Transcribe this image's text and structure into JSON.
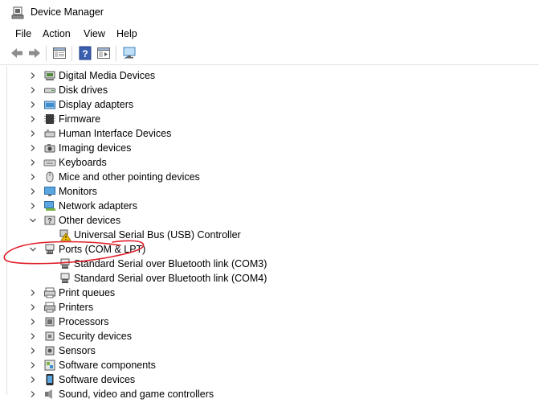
{
  "window": {
    "title": "Device Manager"
  },
  "menu": [
    "File",
    "Action",
    "View",
    "Help"
  ],
  "toolbar": [
    {
      "icon": "back-arrow-icon"
    },
    {
      "icon": "forward-arrow-icon"
    },
    {
      "icon": "show-hide-console-tree-icon"
    },
    {
      "icon": "help-icon"
    },
    {
      "icon": "properties-pane-icon"
    },
    {
      "icon": "monitor-scan-icon"
    }
  ],
  "tree": [
    {
      "label": "Digital Media Devices",
      "icon": "digital-media-icon",
      "state": "collapsed",
      "level": 0
    },
    {
      "label": "Disk drives",
      "icon": "disk-drive-icon",
      "state": "collapsed",
      "level": 0
    },
    {
      "label": "Display adapters",
      "icon": "display-adapter-icon",
      "state": "collapsed",
      "level": 0
    },
    {
      "label": "Firmware",
      "icon": "firmware-chip-icon",
      "state": "collapsed",
      "level": 0
    },
    {
      "label": "Human Interface Devices",
      "icon": "hid-icon",
      "state": "collapsed",
      "level": 0
    },
    {
      "label": "Imaging devices",
      "icon": "camera-icon",
      "state": "collapsed",
      "level": 0
    },
    {
      "label": "Keyboards",
      "icon": "keyboard-icon",
      "state": "collapsed",
      "level": 0
    },
    {
      "label": "Mice and other pointing devices",
      "icon": "mouse-icon",
      "state": "collapsed",
      "level": 0
    },
    {
      "label": "Monitors",
      "icon": "monitor-icon",
      "state": "collapsed",
      "level": 0
    },
    {
      "label": "Network adapters",
      "icon": "network-adapter-icon",
      "state": "collapsed",
      "level": 0
    },
    {
      "label": "Other devices",
      "icon": "other-devices-icon",
      "state": "expanded",
      "level": 0
    },
    {
      "label": "Universal Serial Bus (USB) Controller",
      "icon": "warning-device-icon",
      "state": "leaf",
      "level": 1
    },
    {
      "label": "Ports (COM & LPT)",
      "icon": "port-icon",
      "state": "expanded",
      "level": 0
    },
    {
      "label": "Standard Serial over Bluetooth link (COM3)",
      "icon": "port-icon",
      "state": "leaf",
      "level": 1
    },
    {
      "label": "Standard Serial over Bluetooth link (COM4)",
      "icon": "port-icon",
      "state": "leaf",
      "level": 1
    },
    {
      "label": "Print queues",
      "icon": "print-queue-icon",
      "state": "collapsed",
      "level": 0
    },
    {
      "label": "Printers",
      "icon": "printer-icon",
      "state": "collapsed",
      "level": 0
    },
    {
      "label": "Processors",
      "icon": "processor-icon",
      "state": "collapsed",
      "level": 0
    },
    {
      "label": "Security devices",
      "icon": "security-device-icon",
      "state": "collapsed",
      "level": 0
    },
    {
      "label": "Sensors",
      "icon": "sensor-icon",
      "state": "collapsed",
      "level": 0
    },
    {
      "label": "Software components",
      "icon": "software-component-icon",
      "state": "collapsed",
      "level": 0
    },
    {
      "label": "Software devices",
      "icon": "software-device-icon",
      "state": "collapsed",
      "level": 0
    },
    {
      "label": "Sound, video and game controllers",
      "icon": "sound-icon",
      "state": "collapsed",
      "level": 0
    }
  ],
  "annotation": {
    "color": "#e0202a",
    "target": "Ports (COM & LPT)"
  }
}
